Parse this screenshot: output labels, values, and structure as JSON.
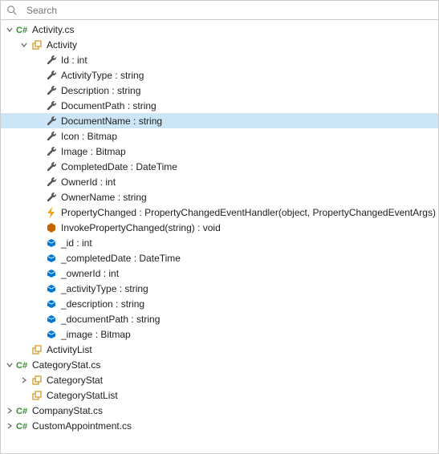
{
  "search": {
    "placeholder": "Search"
  },
  "colors": {
    "selected": "#cde6f7",
    "csharp": "#388a34",
    "class": "#d7a336",
    "wrench": "#555",
    "event": "#f0a30a",
    "method": "#c66400",
    "field": "#0078d4",
    "arrow": "#6a6a6a"
  },
  "tree": [
    {
      "depth": 0,
      "exp": "open",
      "icon": "csharp",
      "label": "Activity.cs",
      "interact": true
    },
    {
      "depth": 1,
      "exp": "open",
      "icon": "class",
      "label": "Activity",
      "interact": true
    },
    {
      "depth": 2,
      "exp": "none",
      "icon": "wrench",
      "label": "Id : int",
      "interact": true
    },
    {
      "depth": 2,
      "exp": "none",
      "icon": "wrench",
      "label": "ActivityType : string",
      "interact": true
    },
    {
      "depth": 2,
      "exp": "none",
      "icon": "wrench",
      "label": "Description : string",
      "interact": true
    },
    {
      "depth": 2,
      "exp": "none",
      "icon": "wrench",
      "label": "DocumentPath : string",
      "interact": true
    },
    {
      "depth": 2,
      "exp": "none",
      "icon": "wrench",
      "label": "DocumentName : string",
      "interact": true,
      "selected": true
    },
    {
      "depth": 2,
      "exp": "none",
      "icon": "wrench",
      "label": "Icon : Bitmap",
      "interact": true
    },
    {
      "depth": 2,
      "exp": "none",
      "icon": "wrench",
      "label": "Image : Bitmap",
      "interact": true
    },
    {
      "depth": 2,
      "exp": "none",
      "icon": "wrench",
      "label": "CompletedDate : DateTime",
      "interact": true
    },
    {
      "depth": 2,
      "exp": "none",
      "icon": "wrench",
      "label": "OwnerId : int",
      "interact": true
    },
    {
      "depth": 2,
      "exp": "none",
      "icon": "wrench",
      "label": "OwnerName : string",
      "interact": true
    },
    {
      "depth": 2,
      "exp": "none",
      "icon": "event",
      "label": "PropertyChanged : PropertyChangedEventHandler(object, PropertyChangedEventArgs)",
      "interact": true
    },
    {
      "depth": 2,
      "exp": "none",
      "icon": "method",
      "label": "InvokePropertyChanged(string) : void",
      "interact": true
    },
    {
      "depth": 2,
      "exp": "none",
      "icon": "field",
      "label": "_id : int",
      "interact": true
    },
    {
      "depth": 2,
      "exp": "none",
      "icon": "field",
      "label": "_completedDate : DateTime",
      "interact": true
    },
    {
      "depth": 2,
      "exp": "none",
      "icon": "field",
      "label": "_ownerId : int",
      "interact": true
    },
    {
      "depth": 2,
      "exp": "none",
      "icon": "field",
      "label": "_activityType : string",
      "interact": true
    },
    {
      "depth": 2,
      "exp": "none",
      "icon": "field",
      "label": "_description : string",
      "interact": true
    },
    {
      "depth": 2,
      "exp": "none",
      "icon": "field",
      "label": "_documentPath : string",
      "interact": true
    },
    {
      "depth": 2,
      "exp": "none",
      "icon": "field",
      "label": "_image : Bitmap",
      "interact": true
    },
    {
      "depth": 1,
      "exp": "none",
      "icon": "class",
      "label": "ActivityList",
      "interact": true
    },
    {
      "depth": 0,
      "exp": "open",
      "icon": "csharp",
      "label": "CategoryStat.cs",
      "interact": true
    },
    {
      "depth": 1,
      "exp": "closed",
      "icon": "class",
      "label": "CategoryStat",
      "interact": true
    },
    {
      "depth": 1,
      "exp": "none",
      "icon": "class",
      "label": "CategoryStatList",
      "interact": true
    },
    {
      "depth": 0,
      "exp": "closed",
      "icon": "csharp",
      "label": "CompanyStat.cs",
      "interact": true
    },
    {
      "depth": 0,
      "exp": "closed",
      "icon": "csharp",
      "label": "CustomAppointment.cs",
      "interact": true
    }
  ]
}
